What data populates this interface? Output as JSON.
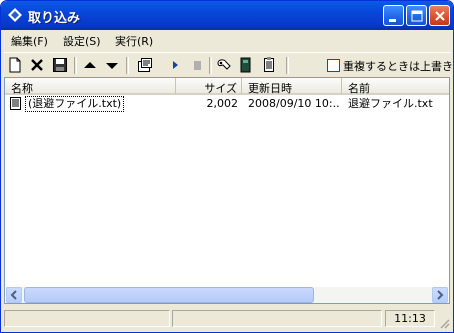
{
  "window": {
    "title": "取り込み"
  },
  "menu": {
    "items": [
      "編集(F)",
      "設定(S)",
      "実行(R)"
    ]
  },
  "toolbar": {
    "tools": [
      "new-file-icon",
      "delete-icon",
      "save-icon",
      "move-up-icon",
      "move-down-icon",
      "properties-icon",
      "play-icon",
      "stop-icon",
      "settings-icon",
      "book-icon",
      "document-icon"
    ],
    "overwrite_checkbox_label": "重複するときは上書き",
    "overwrite_checked": false
  },
  "list": {
    "columns": [
      "名称",
      "サイズ",
      "更新日時",
      "名前"
    ],
    "rows": [
      {
        "name": "(退避ファイル.txt)",
        "size": "2,002",
        "modified": "2008/09/10 10:...",
        "filename": "退避ファイル.txt"
      }
    ]
  },
  "status": {
    "message": "",
    "time": "11:13"
  },
  "colors": {
    "titlebar": "#0846d8",
    "close": "#d9502f",
    "face": "#ece9d8"
  }
}
